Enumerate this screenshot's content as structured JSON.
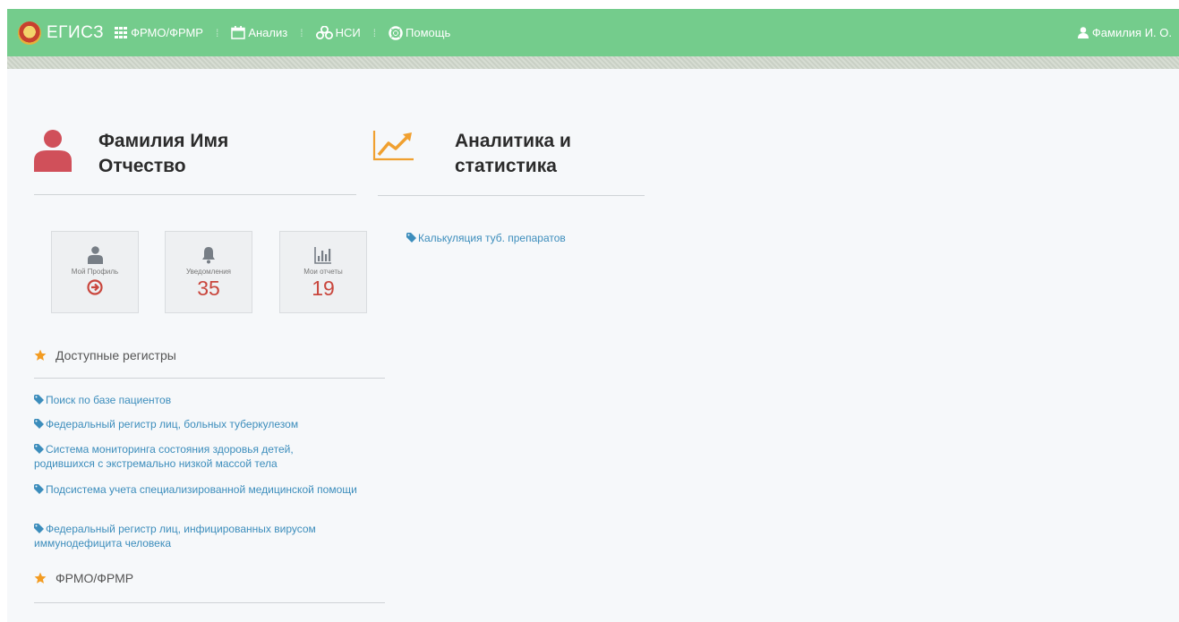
{
  "navbar": {
    "brand": "ЕГИСЗ",
    "items": [
      {
        "label": "ФРМО/ФРМР",
        "icon": "grid-icon"
      },
      {
        "label": "Анализ",
        "icon": "calendar-icon"
      },
      {
        "label": "НСИ",
        "icon": "cubes-icon"
      },
      {
        "label": "Помощь",
        "icon": "lifebuoy-icon"
      }
    ],
    "separator": "⁞",
    "user": "Фамилия И. О."
  },
  "profile": {
    "title_line1": "Фамилия Имя",
    "title_line2": "Отчество"
  },
  "analytics": {
    "title_line1": "Аналитика и",
    "title_line2": "статистика",
    "links": [
      "Калькуляция туб. препаратов"
    ]
  },
  "tiles": [
    {
      "label": "Мой Профиль",
      "icon": "user-icon"
    },
    {
      "label": "Уведомления",
      "value": "35",
      "icon": "bell-icon"
    },
    {
      "label": "Мои отчеты",
      "value": "19",
      "icon": "bar-chart-icon"
    }
  ],
  "registers": {
    "heading": "Доступные регистры",
    "links": [
      "Поиск по базе пациентов",
      "Федеральный регистр лиц, больных туберкулезом",
      "Система мониторинга состояния здоровья детей, родившихся с экстремально низкой массой тела",
      "Подсистема учета специализированной медицинской помощи",
      "Федеральный регистр лиц, инфицированных вирусом иммунодефицита человека"
    ]
  },
  "frmo": {
    "heading": "ФРМО/ФРМР"
  },
  "colors": {
    "navbar": "#74cc8c",
    "link": "#3c8dbc",
    "accent_red": "#c9463d",
    "analytics_orange": "#f0a030",
    "star": "#f39c22"
  }
}
